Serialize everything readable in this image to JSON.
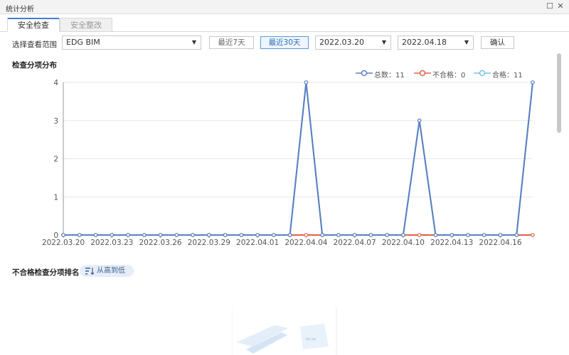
{
  "window": {
    "title": "统计分析"
  },
  "tabs": [
    {
      "label": "安全检查",
      "active": true
    },
    {
      "label": "安全整改",
      "active": false
    }
  ],
  "filter": {
    "scope_label": "选择查看范围",
    "scope_value": "EDG BIM",
    "btn_7days": "最近7天",
    "btn_30days": "最近30天",
    "start_date": "2022.03.20",
    "end_date": "2022.04.18",
    "confirm": "确认"
  },
  "section1": {
    "title": "检查分项分布"
  },
  "legend": [
    {
      "label": "总数：11",
      "color": "#5b7fc0"
    },
    {
      "label": "不合格：0",
      "color": "#e0604a"
    },
    {
      "label": "合格：11",
      "color": "#73c5e0"
    }
  ],
  "section2": {
    "title": "不合格检查分项排名",
    "sort_label": "从高到低",
    "sort_icon": "sort-descending-icon"
  },
  "chart_data": {
    "type": "line",
    "x": [
      "2022.03.20",
      "2022.03.21",
      "2022.03.22",
      "2022.03.23",
      "2022.03.24",
      "2022.03.25",
      "2022.03.26",
      "2022.03.27",
      "2022.03.28",
      "2022.03.29",
      "2022.03.30",
      "2022.03.31",
      "2022.04.01",
      "2022.04.02",
      "2022.04.03",
      "2022.04.04",
      "2022.04.05",
      "2022.04.06",
      "2022.04.07",
      "2022.04.08",
      "2022.04.09",
      "2022.04.10",
      "2022.04.11",
      "2022.04.12",
      "2022.04.13",
      "2022.04.14",
      "2022.04.15",
      "2022.04.16",
      "2022.04.17",
      "2022.04.18"
    ],
    "x_tick_labels": [
      "2022.03.20",
      "2022.03.23",
      "2022.03.26",
      "2022.03.29",
      "2022.04.01",
      "2022.04.04",
      "2022.04.07",
      "2022.04.10",
      "2022.04.13",
      "2022.04.16"
    ],
    "y_ticks": [
      0,
      1,
      2,
      3,
      4
    ],
    "ylim": [
      0,
      4
    ],
    "grid": true,
    "legend_position": "top-right",
    "series": [
      {
        "name": "总数",
        "color": "#5b7fc0",
        "values": [
          0,
          0,
          0,
          0,
          0,
          0,
          0,
          0,
          0,
          0,
          0,
          0,
          0,
          0,
          0,
          4,
          0,
          0,
          0,
          0,
          0,
          0,
          3,
          0,
          0,
          0,
          0,
          0,
          0,
          4
        ]
      },
      {
        "name": "不合格",
        "color": "#e0604a",
        "values": [
          0,
          0,
          0,
          0,
          0,
          0,
          0,
          0,
          0,
          0,
          0,
          0,
          0,
          0,
          0,
          0,
          0,
          0,
          0,
          0,
          0,
          0,
          0,
          0,
          0,
          0,
          0,
          0,
          0,
          0
        ]
      },
      {
        "name": "合格",
        "color": "#73c5e0",
        "values": [
          0,
          0,
          0,
          0,
          0,
          0,
          0,
          0,
          0,
          0,
          0,
          0,
          0,
          0,
          0,
          4,
          0,
          0,
          0,
          0,
          0,
          0,
          3,
          0,
          0,
          0,
          0,
          0,
          0,
          4
        ]
      }
    ]
  }
}
